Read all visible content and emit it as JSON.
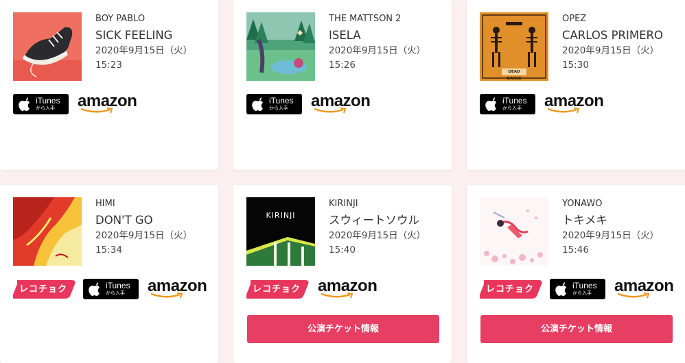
{
  "cards": [
    {
      "artist": "BOY PABLO",
      "title": "SICK FEELING",
      "date": "2020年9月15日（火）",
      "time": "15:23",
      "art_icon": "sneaker-on-red-cover",
      "stores": [
        "itunes",
        "amazon"
      ]
    },
    {
      "artist": "THE MATTSON 2",
      "title": "ISELA",
      "date": "2020年9月15日（火）",
      "time": "15:26",
      "art_icon": "green-landscape-cover",
      "stores": [
        "itunes",
        "amazon"
      ]
    },
    {
      "artist": "OPEZ",
      "title": "CARLOS PRIMERO",
      "date": "2020年9月15日（火）",
      "time": "15:30",
      "art_icon": "skeletons-dead-dance-cover",
      "art_text": "DEAD DANCE",
      "stores": [
        "itunes",
        "amazon"
      ]
    },
    {
      "artist": "HIMI",
      "title": "DON'T GO",
      "date": "2020年9月15日（火）",
      "time": "15:34",
      "art_icon": "red-yellow-abstract-cover",
      "stores": [
        "recochoku",
        "itunes",
        "amazon"
      ]
    },
    {
      "artist": "KIRINJI",
      "title": "スウィートソウル",
      "date": "2020年9月15日（火）",
      "time": "15:40",
      "art_icon": "gas-station-night-cover",
      "art_text": "KIRINJI",
      "stores": [
        "recochoku",
        "amazon"
      ],
      "ticket": "公演チケット情報"
    },
    {
      "artist": "YONAWO",
      "title": "トキメキ",
      "date": "2020年9月15日（火）",
      "time": "15:46",
      "art_icon": "floating-figure-pink-cover",
      "stores": [
        "recochoku",
        "itunes",
        "amazon"
      ],
      "ticket": "公演チケット情報"
    }
  ],
  "badges": {
    "itunes_name": "iTunes",
    "itunes_sub": "から入手",
    "amazon": "amazon",
    "recochoku": "レコチョク"
  },
  "colors": {
    "background": "#fbeff0",
    "ticket_button": "#e73e63",
    "recochoku": "#e8365d",
    "amazon_smile": "#f0961d"
  }
}
